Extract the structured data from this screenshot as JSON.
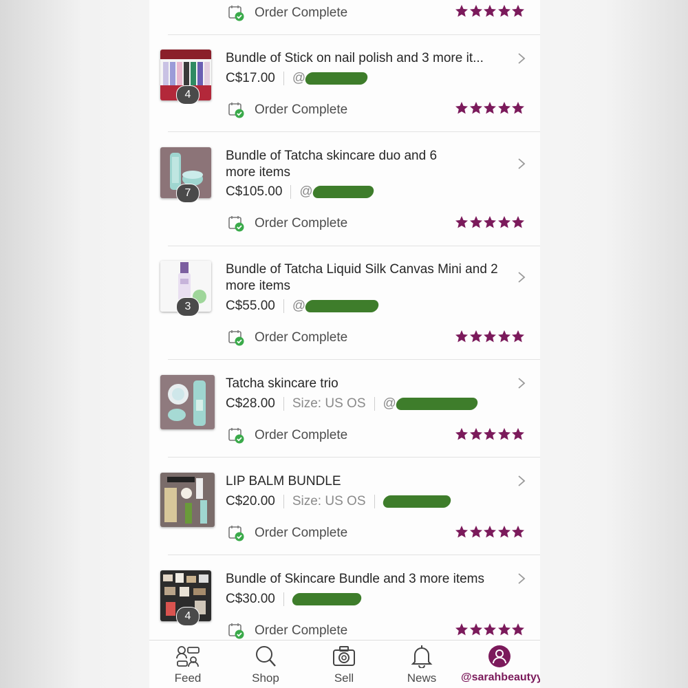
{
  "theme": {
    "accent": "#7b1a5b",
    "status_ok": "#3aaa4a",
    "redaction": "#3e7d2b"
  },
  "orders": [
    {
      "title": "",
      "price": "",
      "count": "",
      "status": "Order Complete",
      "rating": 5
    },
    {
      "title": "Bundle of Stick on nail polish and 3 more it...",
      "price": "C$17.00",
      "size": "",
      "handle_prefix": "@",
      "count": "4",
      "status": "Order Complete",
      "rating": 5
    },
    {
      "title": "Bundle of Tatcha skincare duo and 6 more items",
      "price": "C$105.00",
      "size": "",
      "handle_prefix": "@",
      "count": "7",
      "status": "Order Complete",
      "rating": 5
    },
    {
      "title": "Bundle of Tatcha Liquid Silk Canvas Mini and 2 more items",
      "price": "C$55.00",
      "size": "",
      "handle_prefix": "@",
      "count": "3",
      "status": "Order Complete",
      "rating": 5
    },
    {
      "title": "Tatcha skincare trio",
      "price": "C$28.00",
      "size": "Size: US OS",
      "handle_prefix": "@",
      "count": "",
      "status": "Order Complete",
      "rating": 5
    },
    {
      "title": "LIP BALM BUNDLE",
      "price": "C$20.00",
      "size": "Size: US OS",
      "handle_prefix": "",
      "count": "",
      "status": "Order Complete",
      "rating": 5
    },
    {
      "title": "Bundle of Skincare Bundle and 3 more items",
      "price": "C$30.00",
      "size": "",
      "handle_prefix": "",
      "count": "4",
      "status": "Order Complete",
      "rating": 5
    }
  ],
  "tabs": [
    {
      "label": "Feed",
      "icon": "feed-icon"
    },
    {
      "label": "Shop",
      "icon": "search-icon"
    },
    {
      "label": "Sell",
      "icon": "camera-icon"
    },
    {
      "label": "News",
      "icon": "bell-icon"
    },
    {
      "label": "@sarahbeautyy",
      "icon": "profile-icon",
      "active": true
    }
  ]
}
